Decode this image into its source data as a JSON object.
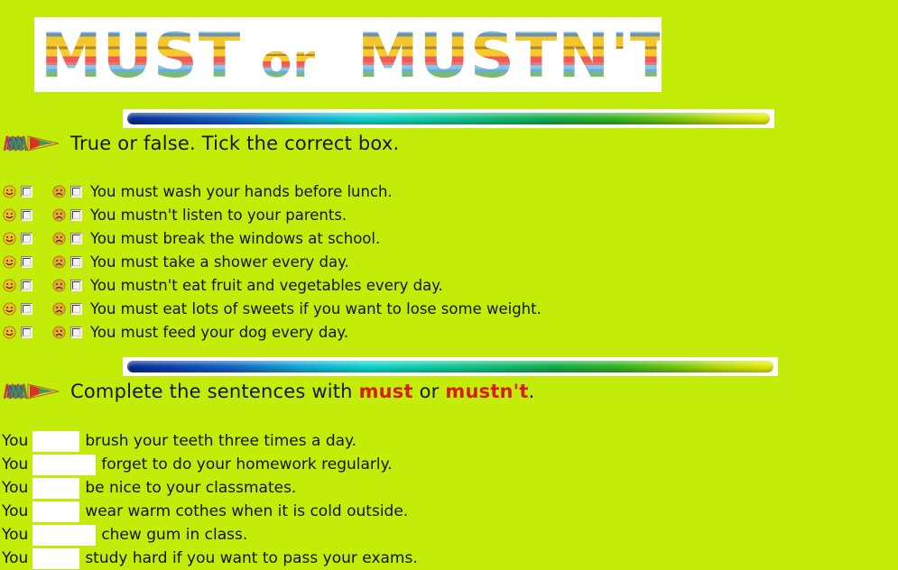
{
  "page": {
    "background_color": "#c3ec08",
    "title": "MUST or MUSTN'T"
  },
  "title_art": {
    "part1": "MUST",
    "part2": "or",
    "part3": "MUSTN'T",
    "style": "rainbow-striped-wordart",
    "banner_color": "#ffffff",
    "stripe_colors": [
      "#6aab5e",
      "#5a7f93",
      "#79b7d8",
      "#f0c020",
      "#f5cc2a",
      "#b0862a",
      "#f2a93b",
      "#ef5a5a",
      "#e8766a",
      "#8dc3e6",
      "#6bb0d4",
      "#7bbd63",
      "#6f93a3",
      "#f3c62b",
      "#c9862f"
    ]
  },
  "dividers": {
    "gradient_stops": [
      "#062a8c",
      "#1263c4",
      "#10d5d0",
      "#11bf7b",
      "#33b321",
      "#b9de08",
      "#e9ef05"
    ],
    "track_color": "#ffffff"
  },
  "section1": {
    "icon": "pencil-icon",
    "heading": "True or false. Tick the correct box.",
    "true_icon": "happy-face-icon",
    "false_icon": "sad-face-icon",
    "items": [
      {
        "text": "You must wash your hands before lunch."
      },
      {
        "text": "You mustn't listen to your parents."
      },
      {
        "text": "You must break the windows at school."
      },
      {
        "text": "You must take a shower every day."
      },
      {
        "text": "You mustn't eat fruit and vegetables every day."
      },
      {
        "text": "You must eat lots of sweets if you want to lose some weight."
      },
      {
        "text": "You must feed your dog every day."
      }
    ]
  },
  "section2": {
    "icon": "pencil-icon",
    "heading_part1": "Complete the sentences with ",
    "heading_keyword1": "must",
    "heading_part2": " or ",
    "heading_keyword2": "mustn't",
    "heading_part3": ".",
    "keyword_color": "#d81e05",
    "blank_value": "",
    "items": [
      {
        "pre": "You",
        "blank_width": 48,
        "post": "brush your teeth three times a day."
      },
      {
        "pre": "You",
        "blank_width": 66,
        "post": "forget to do your homework regularly."
      },
      {
        "pre": "You",
        "blank_width": 48,
        "post": "be nice to your classmates."
      },
      {
        "pre": "You",
        "blank_width": 48,
        "post": "wear warm cothes when it is cold outside."
      },
      {
        "pre": "You",
        "blank_width": 66,
        "post": "chew gum in class."
      },
      {
        "pre": "You",
        "blank_width": 48,
        "post": "study hard if you want to pass your exams."
      }
    ]
  }
}
